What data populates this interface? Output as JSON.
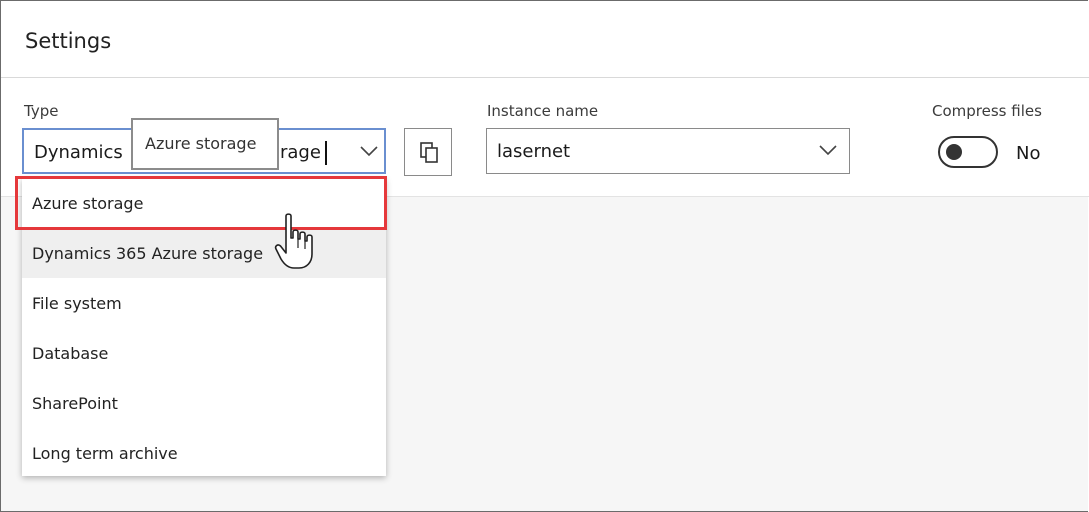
{
  "panel": {
    "title": "Settings"
  },
  "fields": {
    "type": {
      "label": "Type",
      "value_start": "Dynamics",
      "value_end": "rage",
      "tooltip": "Azure storage"
    },
    "instance": {
      "label": "Instance name",
      "value": "lasernet"
    },
    "compress": {
      "label": "Compress files",
      "state": "No"
    }
  },
  "dropdown": {
    "options": [
      "Azure storage",
      "Dynamics 365 Azure storage",
      "File system",
      "Database",
      "SharePoint",
      "Long term archive"
    ]
  },
  "colors": {
    "highlight": "#e5383b",
    "focus_border": "#6a8fd0",
    "hover_bg": "#efefef"
  },
  "icons": {
    "copy": "copy-icon",
    "chevron": "chevron-down-icon",
    "cursor": "hand-pointer-icon"
  }
}
